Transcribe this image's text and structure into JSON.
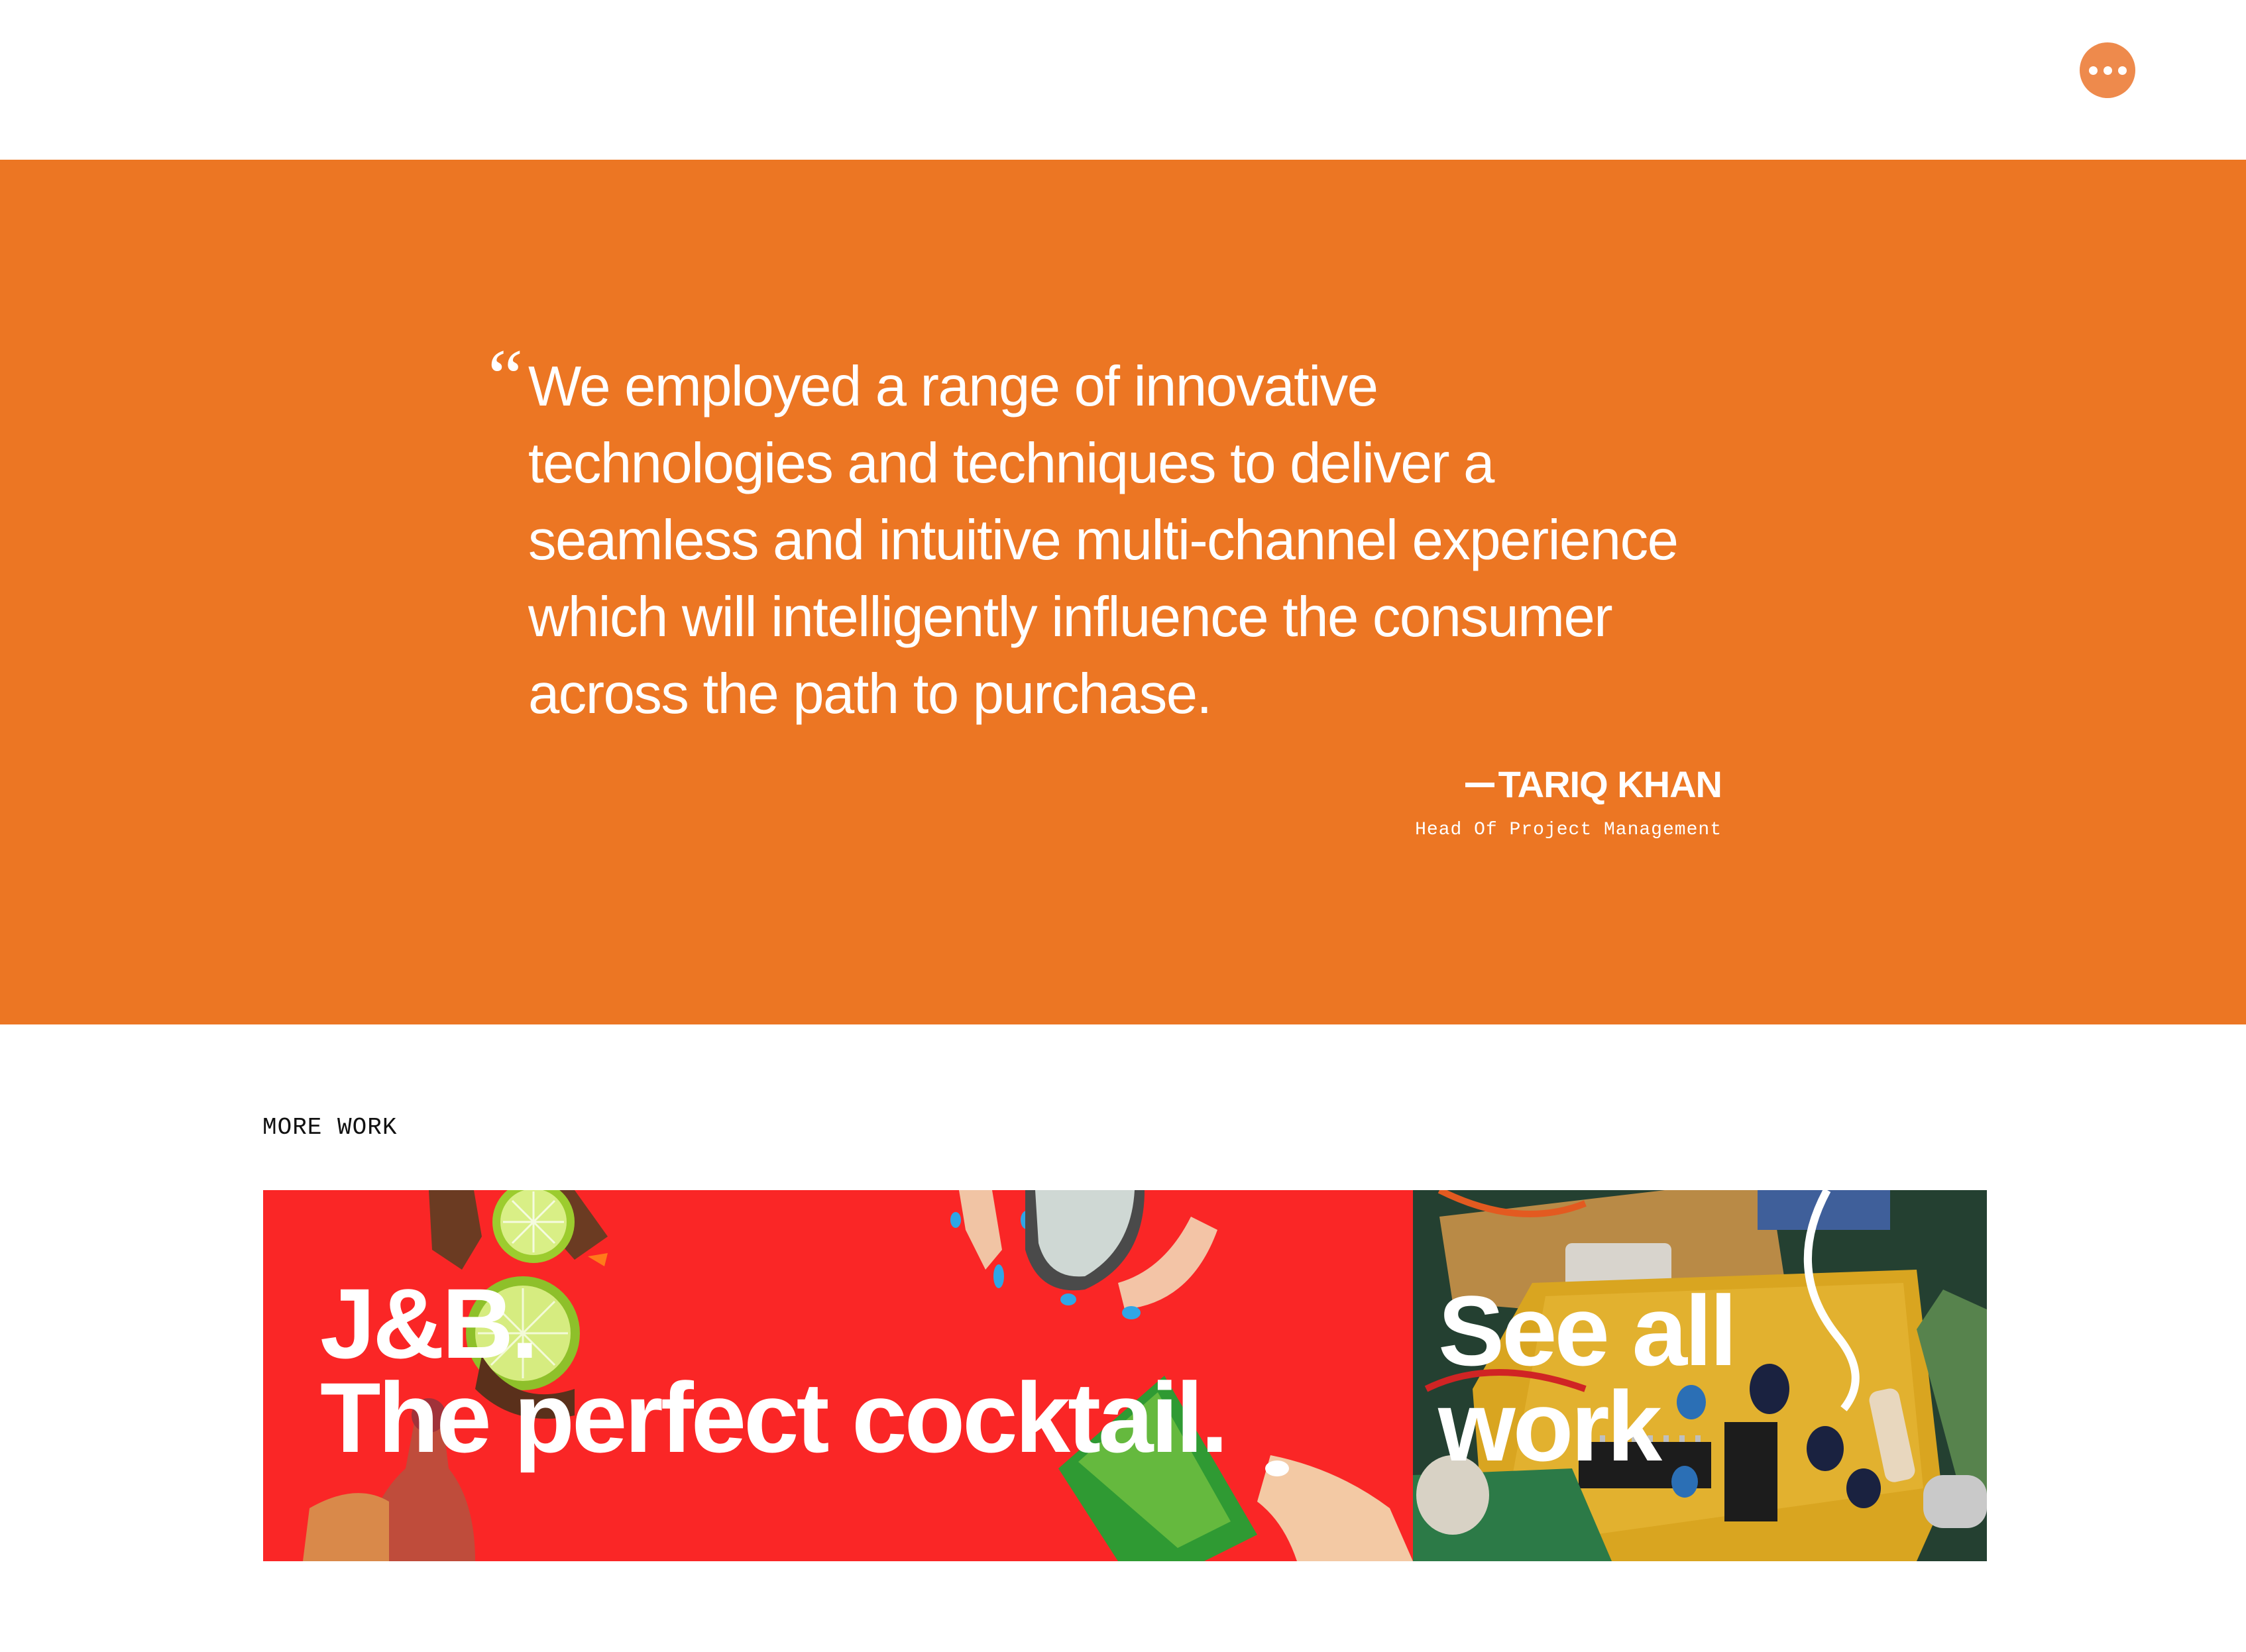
{
  "header": {
    "menu_button": {
      "icon": "more-dots-icon",
      "color": "#ee8a4c"
    }
  },
  "quote": {
    "background": "#ec7623",
    "mark": "“",
    "lines": [
      "We employed a range of innovative",
      "technologies and techniques to deliver a",
      "seamless and intuitive multi-channel experience",
      "which will intelligently influence the consumer",
      "across the path to purchase."
    ],
    "author": {
      "name": "TARIQ KHAN",
      "role": "Head Of Project Management"
    }
  },
  "more_work": {
    "label": "MORE WORK",
    "cards": [
      {
        "title_lines": [
          "J&B.",
          "The perfect cocktail."
        ],
        "background": "#fa2626"
      },
      {
        "title_lines": [
          "See all",
          "work"
        ],
        "background": "#2a4a34"
      }
    ]
  }
}
